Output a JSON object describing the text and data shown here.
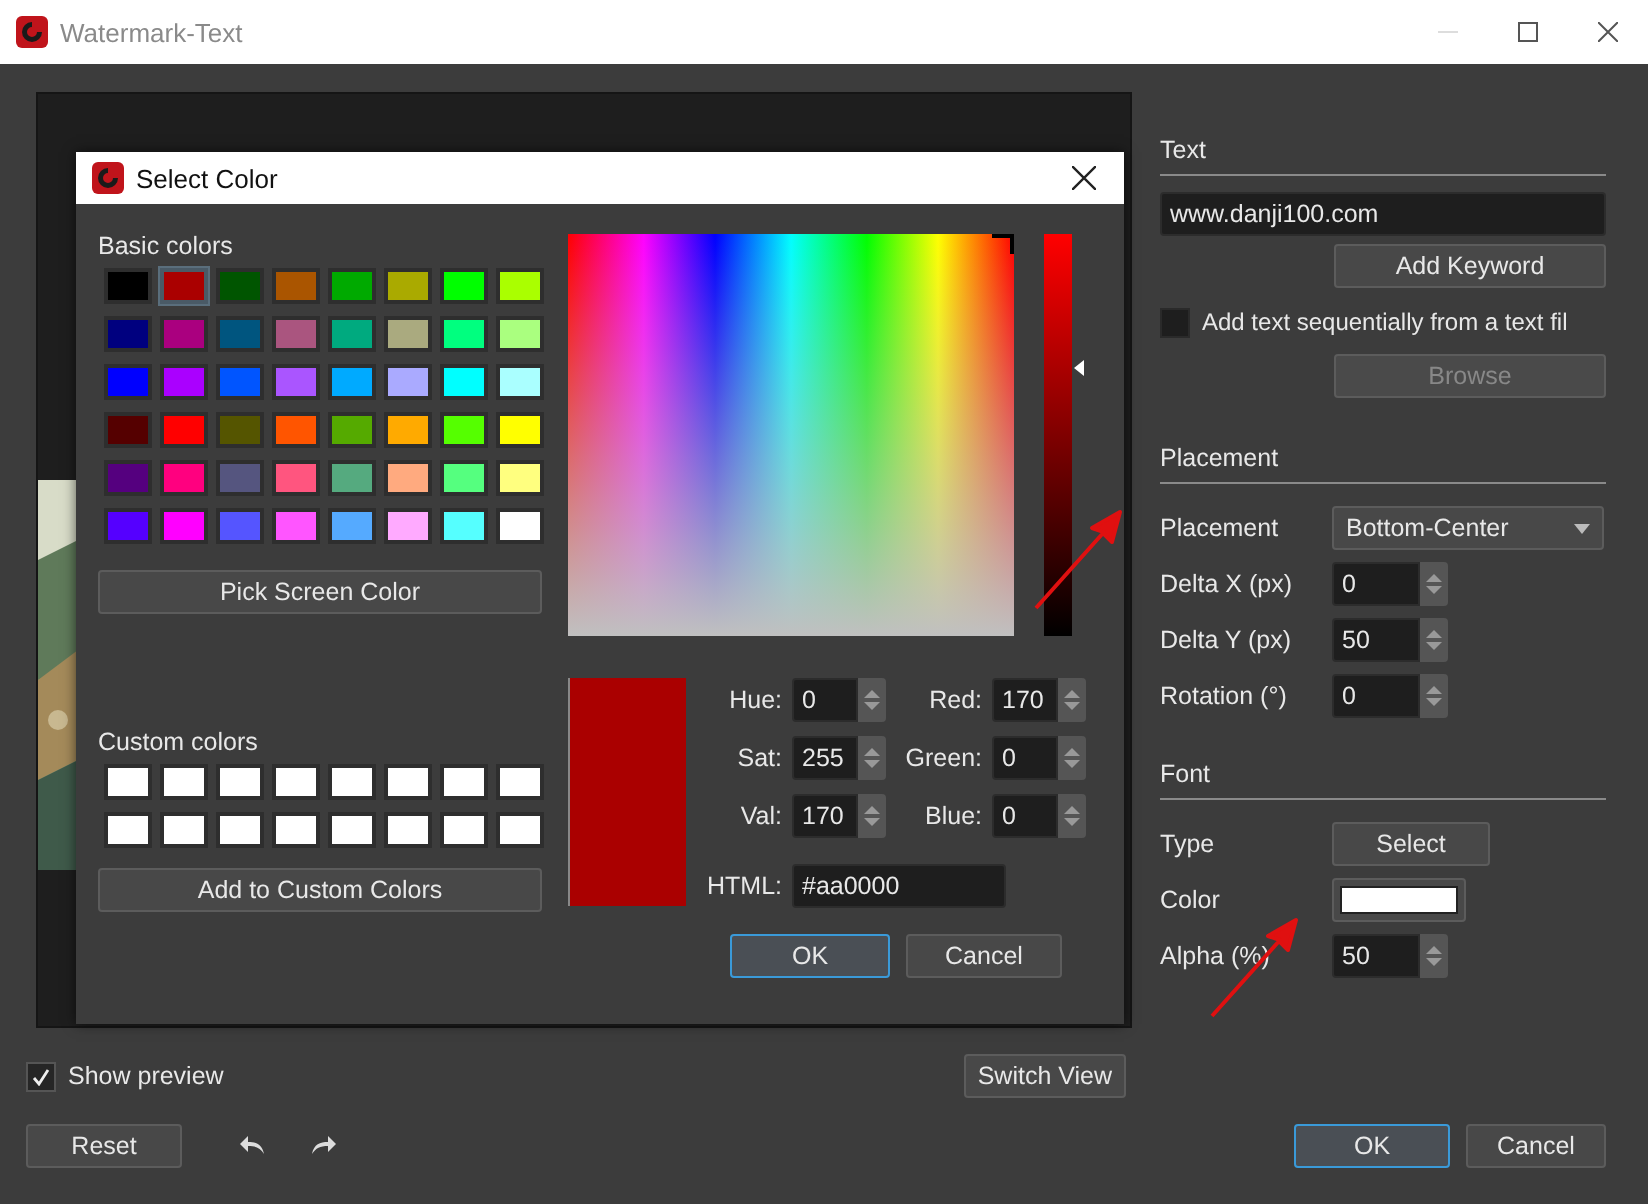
{
  "window": {
    "title": "Watermark-Text"
  },
  "color_dialog": {
    "title": "Select Color",
    "basic_colors_label": "Basic colors",
    "basic_colors": [
      {
        "color": "#000000",
        "selected": false
      },
      {
        "color": "#aa0000",
        "selected": true
      },
      {
        "color": "#005500",
        "selected": false
      },
      {
        "color": "#aa5500",
        "selected": false
      },
      {
        "color": "#00aa00",
        "selected": false
      },
      {
        "color": "#aaaa00",
        "selected": false
      },
      {
        "color": "#00ff00",
        "selected": false
      },
      {
        "color": "#aaff00",
        "selected": false
      },
      {
        "color": "#00007f",
        "selected": false
      },
      {
        "color": "#aa007f",
        "selected": false
      },
      {
        "color": "#00557f",
        "selected": false
      },
      {
        "color": "#aa557f",
        "selected": false
      },
      {
        "color": "#00aa7f",
        "selected": false
      },
      {
        "color": "#aaaa7f",
        "selected": false
      },
      {
        "color": "#00ff7f",
        "selected": false
      },
      {
        "color": "#aaff7f",
        "selected": false
      },
      {
        "color": "#0000ff",
        "selected": false
      },
      {
        "color": "#aa00ff",
        "selected": false
      },
      {
        "color": "#0055ff",
        "selected": false
      },
      {
        "color": "#aa55ff",
        "selected": false
      },
      {
        "color": "#00aaff",
        "selected": false
      },
      {
        "color": "#aaaaff",
        "selected": false
      },
      {
        "color": "#00ffff",
        "selected": false
      },
      {
        "color": "#aaffff",
        "selected": false
      },
      {
        "color": "#550000",
        "selected": false
      },
      {
        "color": "#ff0000",
        "selected": false
      },
      {
        "color": "#555500",
        "selected": false
      },
      {
        "color": "#ff5500",
        "selected": false
      },
      {
        "color": "#55aa00",
        "selected": false
      },
      {
        "color": "#ffaa00",
        "selected": false
      },
      {
        "color": "#55ff00",
        "selected": false
      },
      {
        "color": "#ffff00",
        "selected": false
      },
      {
        "color": "#55007f",
        "selected": false
      },
      {
        "color": "#ff007f",
        "selected": false
      },
      {
        "color": "#55557f",
        "selected": false
      },
      {
        "color": "#ff557f",
        "selected": false
      },
      {
        "color": "#55aa7f",
        "selected": false
      },
      {
        "color": "#ffaa7f",
        "selected": false
      },
      {
        "color": "#55ff7f",
        "selected": false
      },
      {
        "color": "#ffff7f",
        "selected": false
      },
      {
        "color": "#5500ff",
        "selected": false
      },
      {
        "color": "#ff00ff",
        "selected": false
      },
      {
        "color": "#5555ff",
        "selected": false
      },
      {
        "color": "#ff55ff",
        "selected": false
      },
      {
        "color": "#55aaff",
        "selected": false
      },
      {
        "color": "#ffaaff",
        "selected": false
      },
      {
        "color": "#55ffff",
        "selected": false
      },
      {
        "color": "#ffffff",
        "selected": false
      }
    ],
    "pick_screen_color": "Pick Screen Color",
    "custom_colors_label": "Custom colors",
    "custom_colors": [
      {
        "color": "#ffffff"
      },
      {
        "color": "#ffffff"
      },
      {
        "color": "#ffffff"
      },
      {
        "color": "#ffffff"
      },
      {
        "color": "#ffffff"
      },
      {
        "color": "#ffffff"
      },
      {
        "color": "#ffffff"
      },
      {
        "color": "#ffffff"
      },
      {
        "color": "#ffffff"
      },
      {
        "color": "#ffffff"
      },
      {
        "color": "#ffffff"
      },
      {
        "color": "#ffffff"
      },
      {
        "color": "#ffffff"
      },
      {
        "color": "#ffffff"
      },
      {
        "color": "#ffffff"
      },
      {
        "color": "#ffffff"
      }
    ],
    "add_to_custom_colors": "Add to Custom Colors",
    "value_slider": {
      "level": 0.667
    },
    "fields": [
      {
        "label": "Hue:",
        "value": "0"
      },
      {
        "label": "Red:",
        "value": "170"
      },
      {
        "label": "Sat:",
        "value": "255"
      },
      {
        "label": "Green:",
        "value": "0"
      },
      {
        "label": "Val:",
        "value": "170"
      },
      {
        "label": "Blue:",
        "value": "0"
      }
    ],
    "html": {
      "label": "HTML:",
      "value": "#aa0000"
    },
    "buttons": [
      {
        "label": "OK",
        "default": true
      },
      {
        "label": "Cancel",
        "default": false
      }
    ]
  },
  "text_section": {
    "heading": "Text",
    "text_value": "www.danji100.com",
    "add_keyword": "Add Keyword",
    "sequential": {
      "label": "Add text sequentially from a text fil",
      "checked": false
    },
    "browse": {
      "label": "Browse",
      "disabled": true
    }
  },
  "placement_section": {
    "heading": "Placement",
    "placement": {
      "label": "Placement",
      "value": "Bottom-Center"
    },
    "spins": [
      {
        "label": "Delta X (px)",
        "value": "0"
      },
      {
        "label": "Delta Y (px)",
        "value": "50"
      },
      {
        "label": "Rotation (°)",
        "value": "0"
      }
    ]
  },
  "font_section": {
    "heading": "Font",
    "type": {
      "label": "Type",
      "button": "Select"
    },
    "color": {
      "label": "Color",
      "color": "#ffffff"
    },
    "alpha": {
      "label": "Alpha (%)",
      "value": "50"
    }
  },
  "show_preview": {
    "label": "Show preview",
    "checked": true
  },
  "switch_view": "Switch View",
  "reset": "Reset",
  "buttons": [
    {
      "label": "OK",
      "default": true
    },
    {
      "label": "Cancel",
      "default": false
    }
  ]
}
